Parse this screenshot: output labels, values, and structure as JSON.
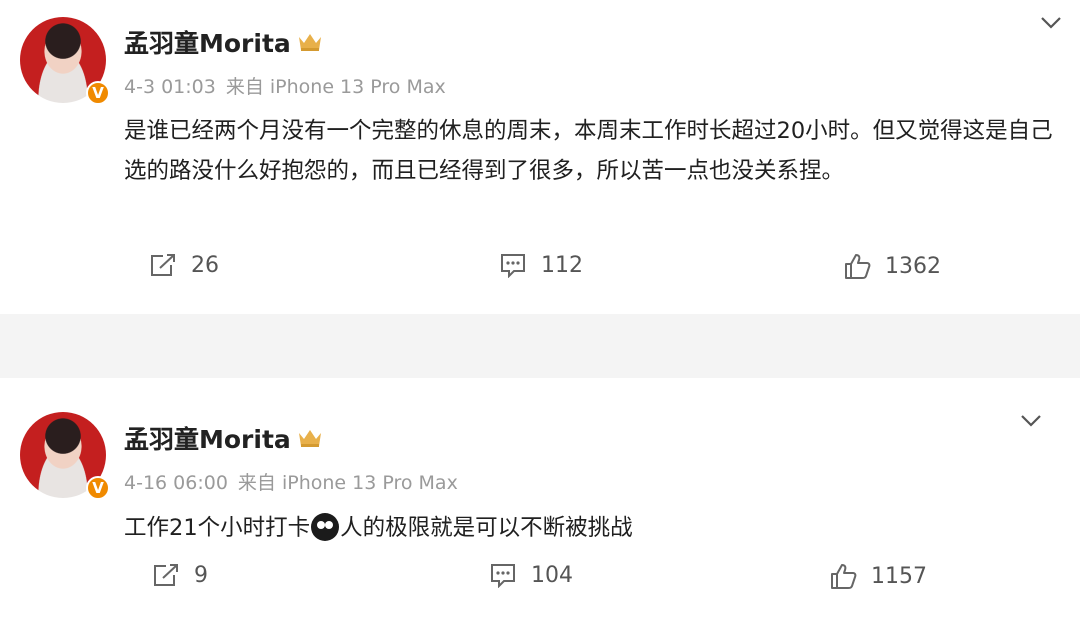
{
  "posts": [
    {
      "author": "孟羽童Morita",
      "date": "4-3 01:03",
      "source": "来自 iPhone 13 Pro Max",
      "text": "是谁已经两个月没有一个完整的休息的周末，本周末工作时长超过20小时。但又觉得这是自己选的路没什么好抱怨的，而且已经得到了很多，所以苦一点也没关系捏。",
      "reposts": "26",
      "comments": "112",
      "likes": "1362"
    },
    {
      "author": "孟羽童Morita",
      "date": "4-16 06:00",
      "source": "来自 iPhone 13 Pro Max",
      "text_before": "工作21个小时打卡",
      "text_after": "人的极限就是可以不断被挑战",
      "reposts": "9",
      "comments": "104",
      "likes": "1157"
    }
  ],
  "colors": {
    "verified_badge": "#f08a00",
    "avatar_bg": "#c41f1f",
    "crown": "#e8b04a"
  },
  "icons": [
    "verified-v-icon",
    "crown-icon",
    "chevron-down-icon",
    "repost-icon",
    "comment-icon",
    "like-icon",
    "emoji-icon"
  ]
}
